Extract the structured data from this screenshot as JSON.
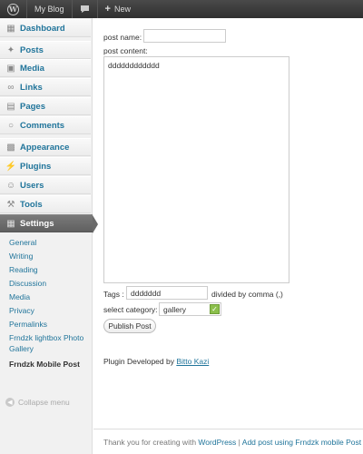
{
  "adminbar": {
    "site_name": "My Blog",
    "new_label": "New",
    "icons": [
      "wordpress-logo-icon",
      "comment-bubble-icon",
      "plus-icon"
    ]
  },
  "sidebar": {
    "items": [
      {
        "label": "Dashboard",
        "icon": "dashboard-icon"
      },
      {
        "label": "Posts",
        "icon": "pushpin-icon"
      },
      {
        "label": "Media",
        "icon": "media-icon"
      },
      {
        "label": "Links",
        "icon": "link-icon"
      },
      {
        "label": "Pages",
        "icon": "pages-icon"
      },
      {
        "label": "Comments",
        "icon": "comment-icon"
      },
      {
        "label": "Appearance",
        "icon": "appearance-icon"
      },
      {
        "label": "Plugins",
        "icon": "plugin-icon"
      },
      {
        "label": "Users",
        "icon": "users-icon"
      },
      {
        "label": "Tools",
        "icon": "tools-icon"
      },
      {
        "label": "Settings",
        "icon": "settings-icon"
      }
    ],
    "submenu": [
      "General",
      "Writing",
      "Reading",
      "Discussion",
      "Media",
      "Privacy",
      "Permalinks",
      "Frndzk lightbox Photo",
      "Gallery",
      "Frndzk Mobile Post"
    ],
    "collapse_label": "Collapse menu"
  },
  "form": {
    "post_name_label": "post name:",
    "post_name_value": "",
    "post_content_label": "post content:",
    "post_content_value": "dddddddddddd",
    "tags_label": "Tags :",
    "tags_value": "ddddddd",
    "tags_hint": "divided by comma (,)",
    "category_label": "select category:",
    "category_value": "gallery",
    "submit_label": "Publish Post"
  },
  "credit": {
    "prefix": "Plugin Developed by",
    "author": "Bitto Kazi"
  },
  "footer": {
    "prefix": "Thank you for creating with",
    "wordpress_link": "WordPress",
    "separator": " | ",
    "plugin_link": "Add post using Frndzk mobile Post"
  },
  "colors": {
    "link": "#21759b",
    "adminbar": "#464646",
    "active_menu": "#6a6a6a",
    "select_arrow": "#8bbf4b"
  }
}
